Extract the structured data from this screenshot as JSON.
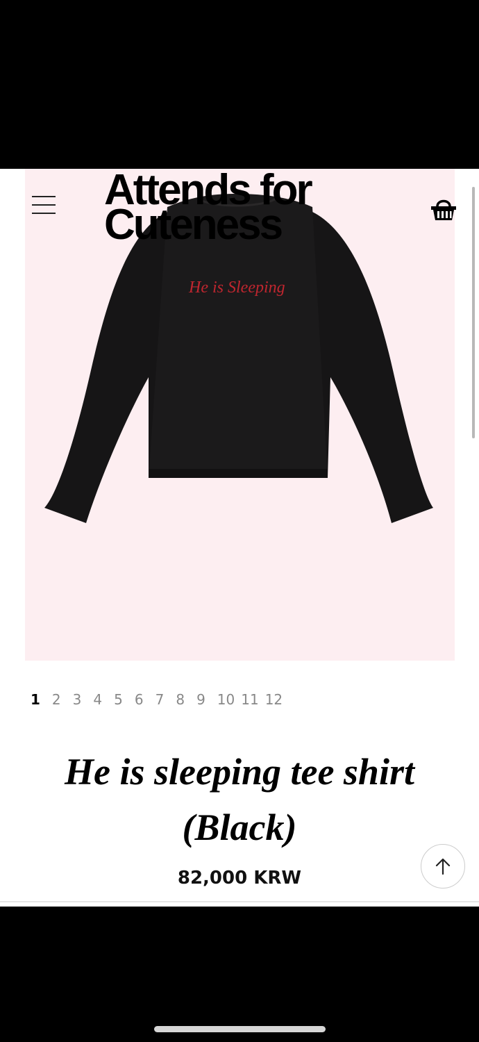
{
  "header": {
    "brand_line1": "Attends for",
    "brand_line2": "Cuteness",
    "menu_icon": "hamburger-menu-icon",
    "cart_icon": "shopping-basket-icon"
  },
  "product": {
    "image_text": "He is Sleeping",
    "image_alt": "black long sleeve tee with red embroidered script",
    "title_line1": "He is sleeping tee shirt",
    "title_line2": "(Black)",
    "price": "82,000 KRW"
  },
  "gallery": {
    "pages": [
      "1",
      "2",
      "3",
      "4",
      "5",
      "6",
      "7",
      "8",
      "9",
      "10",
      "11",
      "12"
    ],
    "active": "1"
  },
  "scroll_top": {
    "icon": "arrow-up-icon"
  },
  "colors": {
    "hero_bg": "#fdeef1",
    "shirt": "#161516",
    "embroidery": "#c0262f"
  }
}
